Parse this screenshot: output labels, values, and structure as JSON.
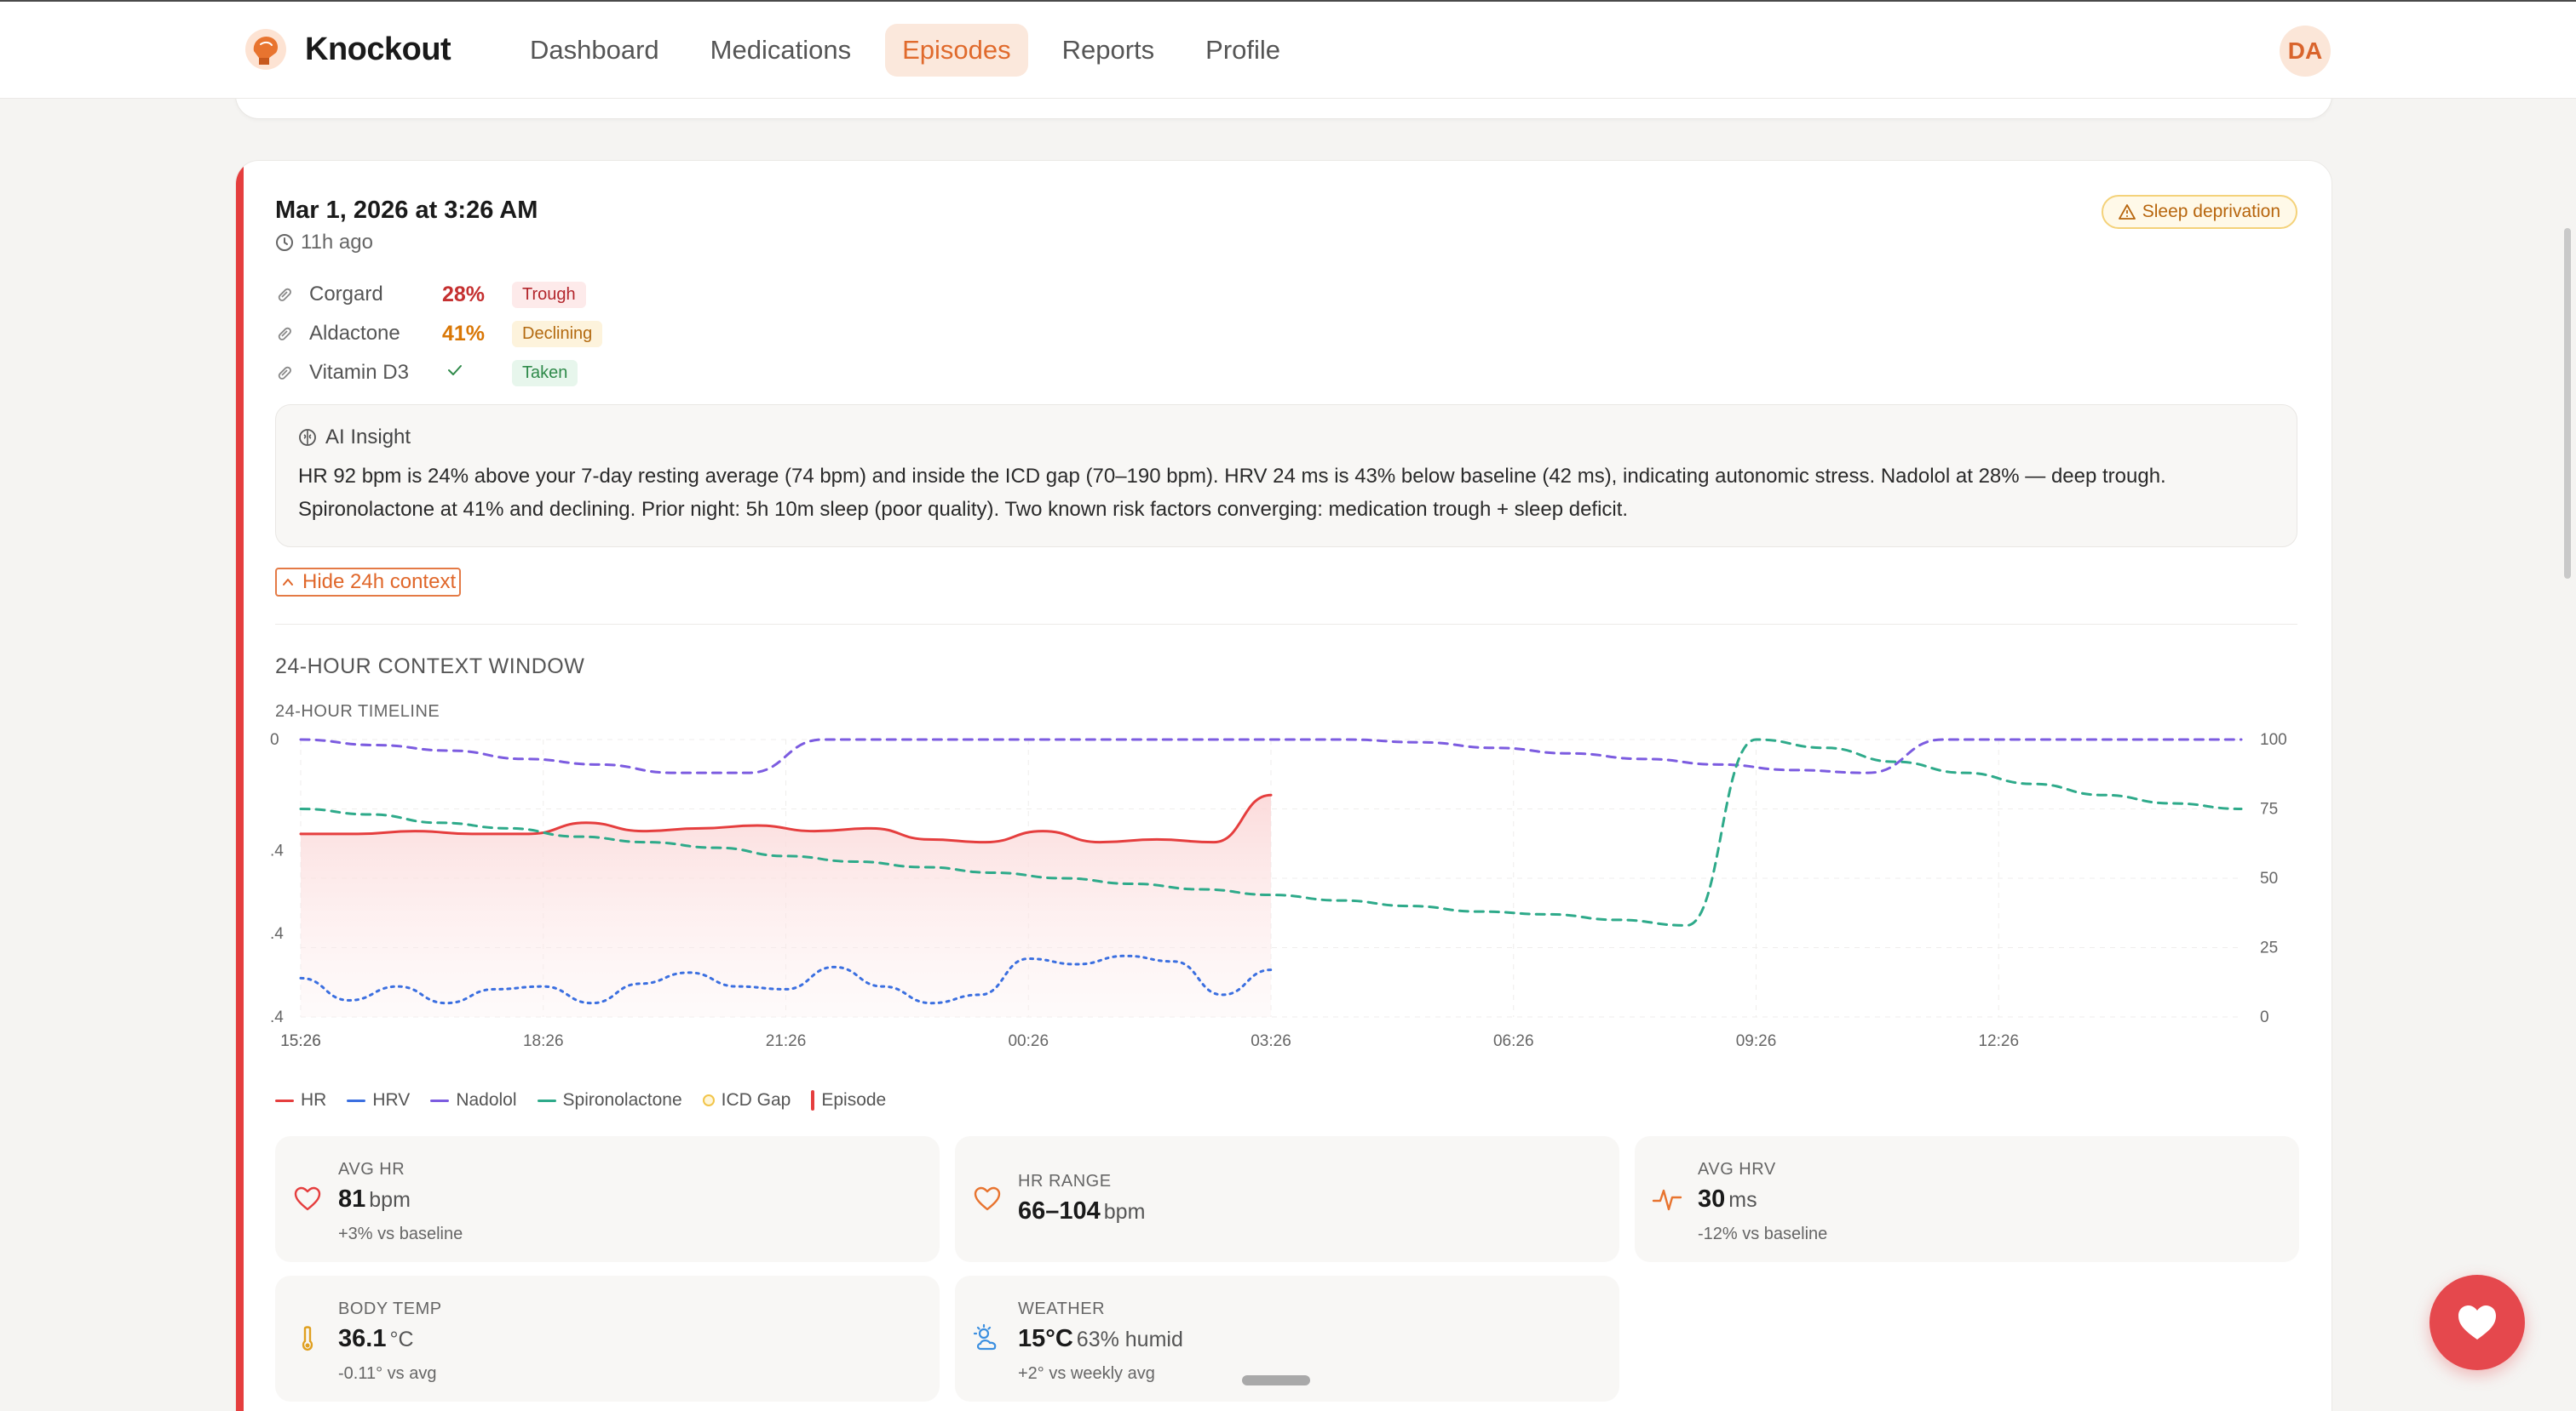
{
  "app": {
    "name": "Knockout",
    "nav": [
      {
        "label": "Dashboard"
      },
      {
        "label": "Medications"
      },
      {
        "label": "Episodes"
      },
      {
        "label": "Reports"
      },
      {
        "label": "Profile"
      }
    ],
    "active_nav": "Episodes",
    "user_initials": "DA"
  },
  "episode": {
    "title": "Mar 1, 2026 at 3:26 AM",
    "ago": "11h ago",
    "trigger_badge": "Sleep deprivation",
    "medications": [
      {
        "name": "Corgard",
        "level": "28%",
        "status": "Trough",
        "level_color": "#c53030"
      },
      {
        "name": "Aldactone",
        "level": "41%",
        "status": "Declining",
        "level_color": "#d97706"
      },
      {
        "name": "Vitamin D3",
        "level": "",
        "status": "Taken",
        "level_color": "#2f8a4a"
      }
    ],
    "insight": {
      "title": "AI Insight",
      "body": "HR 92 bpm is 24% above your 7-day resting average (74 bpm) and inside the ICD gap (70–190 bpm). HRV 24 ms is 43% below baseline (42 ms), indicating autonomic stress. Nadolol at 28% — deep trough. Spironolactone at 41% and declining. Prior night: 5h 10m sleep (poor quality). Two known risk factors converging: medication trough + sleep deficit."
    },
    "toggle_label": "Hide 24h context",
    "context_title": "24-HOUR CONTEXT WINDOW",
    "timeline_title": "24-HOUR TIMELINE"
  },
  "legend": [
    {
      "name": "HR",
      "color": "#e53e3e",
      "kind": "line"
    },
    {
      "name": "HRV",
      "color": "#3b6fe0",
      "kind": "line"
    },
    {
      "name": "Nadolol",
      "color": "#7c5ce0",
      "kind": "line"
    },
    {
      "name": "Spironolactone",
      "color": "#2eaa8a",
      "kind": "line"
    },
    {
      "name": "ICD Gap",
      "color": "#f2c54a",
      "kind": "dot"
    },
    {
      "name": "Episode",
      "color": "#e53e3e",
      "kind": "bar"
    }
  ],
  "stats": [
    {
      "label": "AVG HR",
      "value": "81",
      "unit": "bpm",
      "sub": "+3% vs baseline",
      "icon": "heart-icon"
    },
    {
      "label": "HR RANGE",
      "value": "66–104",
      "unit": "bpm",
      "sub": "",
      "icon": "heart-icon"
    },
    {
      "label": "AVG HRV",
      "value": "30",
      "unit": "ms",
      "sub": "-12% vs baseline",
      "icon": "pulse-icon"
    },
    {
      "label": "BODY TEMP",
      "value": "36.1",
      "unit": "°C",
      "sub": "-0.11° vs avg",
      "icon": "thermometer-icon"
    },
    {
      "label": "WEATHER",
      "value": "15°C",
      "unit": "63% humid",
      "sub": "+2° vs weekly avg",
      "icon": "weather-icon"
    }
  ],
  "chart_data": {
    "type": "line",
    "x": [
      "15:26",
      "16:26",
      "17:26",
      "18:26",
      "19:26",
      "20:26",
      "21:26",
      "22:26",
      "23:26",
      "00:26",
      "01:26",
      "02:26",
      "03:26",
      "04:26",
      "05:26",
      "06:26",
      "07:26",
      "08:26",
      "09:26",
      "10:26",
      "11:26",
      "12:26",
      "13:26",
      "14:26",
      "15:26"
    ],
    "x_ticks": [
      "15:26",
      "18:26",
      "21:26",
      "00:26",
      "03:26",
      "06:26",
      "09:26",
      "12:26",
      "15:26"
    ],
    "left_ticks": [
      "0",
      ".4",
      ".4",
      ".4"
    ],
    "right_ticks": [
      "100",
      "75",
      "50",
      "25",
      "0"
    ],
    "right_ylim": [
      0,
      100
    ],
    "grid": true,
    "series": [
      {
        "name": "HR",
        "color": "#e53e3e",
        "values": [
          66,
          66,
          67,
          66,
          66,
          70,
          67,
          68,
          69,
          67,
          68,
          64,
          63,
          67,
          63,
          64,
          63,
          80
        ],
        "note_y": "0-100 scale, ends at episode"
      },
      {
        "name": "HRV",
        "color": "#3b6fe0",
        "values": [
          14,
          6,
          11,
          5,
          10,
          11,
          5,
          12,
          16,
          11,
          10,
          18,
          11,
          5,
          8,
          21,
          19,
          22,
          20,
          8,
          17
        ]
      },
      {
        "name": "Nadolol",
        "color": "#7c5ce0",
        "values": [
          100,
          98,
          96,
          93,
          91,
          88,
          88,
          100,
          100,
          100,
          100,
          100,
          100,
          100,
          100,
          99,
          97,
          95,
          93,
          91,
          89,
          88,
          100,
          100,
          100,
          100,
          100
        ]
      },
      {
        "name": "Spironolactone",
        "color": "#2eaa8a",
        "values": [
          75,
          73,
          70,
          68,
          65,
          63,
          61,
          58,
          56,
          54,
          52,
          50,
          48,
          46,
          44,
          42,
          40,
          38,
          37,
          35,
          33,
          100,
          97,
          92,
          88,
          84,
          80,
          77,
          75
        ]
      }
    ],
    "legend_position": "bottom-left"
  }
}
